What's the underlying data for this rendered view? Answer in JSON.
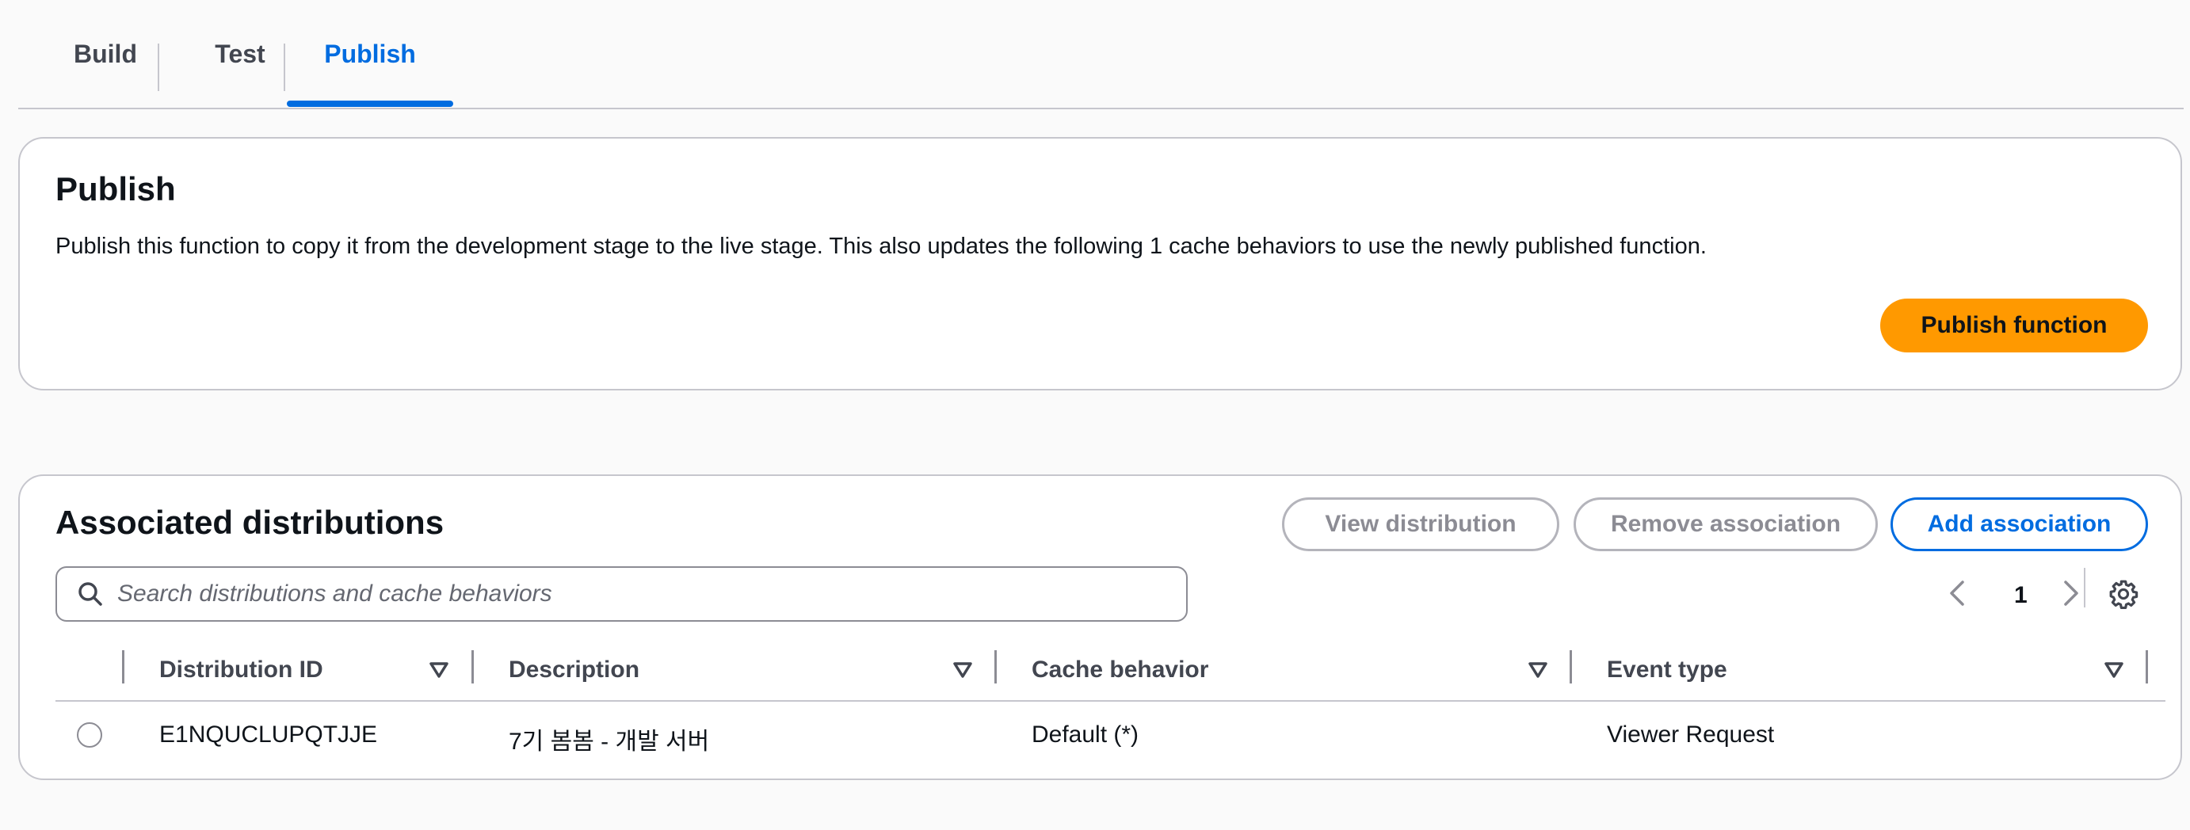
{
  "tabs": [
    {
      "label": "Build"
    },
    {
      "label": "Test"
    },
    {
      "label": "Publish"
    }
  ],
  "active_tab": "Publish",
  "publish_card": {
    "title": "Publish",
    "description": "Publish this function to copy it from the development stage to the live stage. This also updates the following 1 cache behaviors to use the newly published function.",
    "publish_button": "Publish function"
  },
  "distributions_card": {
    "title": "Associated distributions",
    "view_button": "View distribution",
    "remove_button": "Remove association",
    "add_button": "Add association",
    "search_placeholder": "Search distributions and cache behaviors",
    "page_number": "1",
    "columns": [
      "Distribution ID",
      "Description",
      "Cache behavior",
      "Event type"
    ],
    "rows": [
      {
        "distribution_id": "E1NQUCLUPQTJJE",
        "description": "7기 봄봄 - 개발 서버",
        "cache_behavior": "Default (*)",
        "event_type": "Viewer Request"
      }
    ]
  },
  "colors": {
    "accent": "#006ce0",
    "primary_button": "#ff9900",
    "border": "#c6c6cd"
  },
  "icons": [
    "search-icon",
    "chevron-left-icon",
    "chevron-right-icon",
    "gear-icon",
    "sort-down-icon"
  ]
}
